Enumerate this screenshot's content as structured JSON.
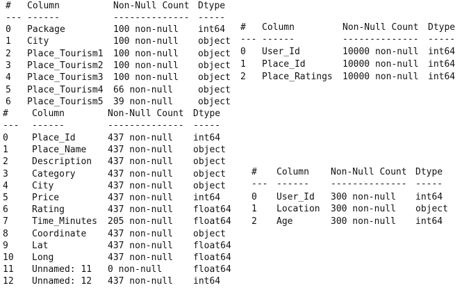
{
  "tables": [
    {
      "id": "package",
      "headers": [
        "#",
        "Column",
        "Non-Null Count",
        "Dtype"
      ],
      "separators": [
        "---",
        "------",
        "--------------",
        "-----"
      ],
      "rows": [
        [
          "0",
          "Package",
          "100 non-null",
          "int64"
        ],
        [
          "1",
          "City",
          "100 non-null",
          "object"
        ],
        [
          "2",
          "Place_Tourism1",
          "100 non-null",
          "object"
        ],
        [
          "3",
          "Place_Tourism2",
          "100 non-null",
          "object"
        ],
        [
          "4",
          "Place_Tourism3",
          "100 non-null",
          "object"
        ],
        [
          "5",
          "Place_Tourism4",
          "66 non-null",
          "object"
        ],
        [
          "6",
          "Place_Tourism5",
          "39 non-null",
          "object"
        ]
      ]
    },
    {
      "id": "ratings",
      "headers": [
        "#",
        "Column",
        "Non-Null Count",
        "Dtype"
      ],
      "separators": [
        "---",
        "------",
        "--------------",
        "-----"
      ],
      "rows": [
        [
          "0",
          "User_Id",
          "10000 non-null",
          "int64"
        ],
        [
          "1",
          "Place_Id",
          "10000 non-null",
          "int64"
        ],
        [
          "2",
          "Place_Ratings",
          "10000 non-null",
          "int64"
        ]
      ]
    },
    {
      "id": "places",
      "headers": [
        "#",
        "Column",
        "Non-Null Count",
        "Dtype"
      ],
      "separators": [
        "---",
        "------",
        "--------------",
        "-----"
      ],
      "rows": [
        [
          "0",
          "Place_Id",
          "437 non-null",
          "int64"
        ],
        [
          "1",
          "Place_Name",
          "437 non-null",
          "object"
        ],
        [
          "2",
          "Description",
          "437 non-null",
          "object"
        ],
        [
          "3",
          "Category",
          "437 non-null",
          "object"
        ],
        [
          "4",
          "City",
          "437 non-null",
          "object"
        ],
        [
          "5",
          "Price",
          "437 non-null",
          "int64"
        ],
        [
          "6",
          "Rating",
          "437 non-null",
          "float64"
        ],
        [
          "7",
          "Time_Minutes",
          "205 non-null",
          "float64"
        ],
        [
          "8",
          "Coordinate",
          "437 non-null",
          "object"
        ],
        [
          "9",
          "Lat",
          "437 non-null",
          "float64"
        ],
        [
          "10",
          "Long",
          "437 non-null",
          "float64"
        ],
        [
          "11",
          "Unnamed: 11",
          "0 non-null",
          "float64"
        ],
        [
          "12",
          "Unnamed: 12",
          "437 non-null",
          "int64"
        ]
      ]
    },
    {
      "id": "users",
      "headers": [
        "#",
        "Column",
        "Non-Null Count",
        "Dtype"
      ],
      "separators": [
        "---",
        "------",
        "--------------",
        "-----"
      ],
      "rows": [
        [
          "0",
          "User_Id",
          "300 non-null",
          "int64"
        ],
        [
          "1",
          "Location",
          "300 non-null",
          "object"
        ],
        [
          "2",
          "Age",
          "300 non-null",
          "int64"
        ]
      ]
    }
  ]
}
